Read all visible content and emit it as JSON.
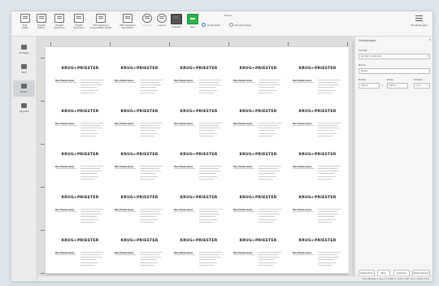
{
  "toolbar": {
    "buttons": [
      {
        "label": "Erst-\nEdtgs",
        "icon": "document-icon"
      },
      {
        "label": "Projekt\nÖffnen",
        "icon": "folder-open-icon"
      },
      {
        "label": "Projekt\nSpeichern",
        "icon": "save-icon"
      },
      {
        "label": "Projekt\nSpeichern",
        "icon": "save-as-icon"
      },
      {
        "label": "PDF speichern\nausgewählte Seiten",
        "icon": "pdf-export-icon"
      },
      {
        "label": "PDF speichern\nalle Seiten",
        "icon": "pdf-export-all-icon"
      },
      {
        "label": "Drucken",
        "icon": "print-icon"
      },
      {
        "label": "Layout",
        "icon": "layout-icon"
      },
      {
        "label": "Auswahl",
        "icon": "select-icon"
      },
      {
        "label": "Neu",
        "icon": "add-icon"
      }
    ],
    "group_title": "Modus",
    "radio": [
      {
        "label": "Ausschnitt",
        "selected": true
      },
      {
        "label": "Druckvorlage",
        "selected": false
      }
    ],
    "menu_label": "Einstellungen"
  },
  "sidebar": {
    "items": [
      {
        "label": "Vorlagen",
        "icon": "templates-icon"
      },
      {
        "label": "Text",
        "icon": "text-icon"
      },
      {
        "label": "Bilder",
        "icon": "image-icon"
      },
      {
        "label": "Objekte",
        "icon": "objects-icon"
      }
    ],
    "active": 2
  },
  "cards": {
    "brand": "KRUG+PRIESTER",
    "person": "Max Mustermann",
    "rows": 5,
    "cols": 5
  },
  "panel": {
    "title": "Einstellungen",
    "close": "X",
    "format_label": "Format",
    "format_value": "A4 297 x 210 mm",
    "name_label": "Name",
    "name_value": "Name",
    "width_label": "Breite",
    "width_value": "210,0",
    "height_label": "Höhe",
    "height_value": "297,0",
    "unit_label": "Einheit",
    "unit_value": "mm",
    "buttons": [
      "Abbrechen",
      "Neu",
      "Löschen",
      "Übernehmen"
    ]
  },
  "status": {
    "text": "Druckbogen 1 von 1 | Seite 1 | 210 x 297 mm | Zoom 54%"
  }
}
